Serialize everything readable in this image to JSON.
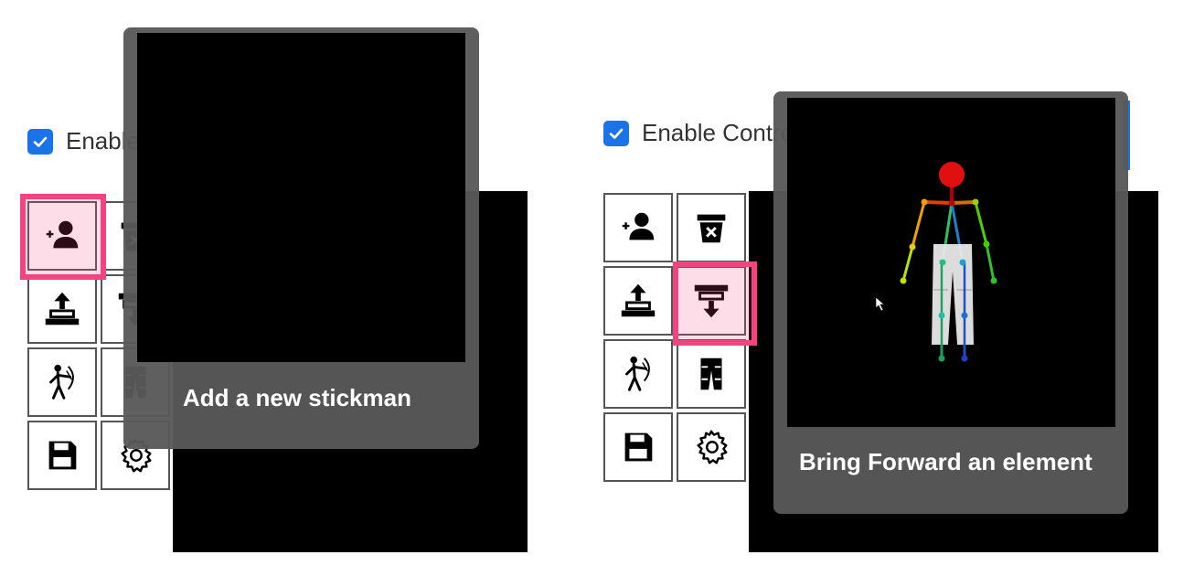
{
  "left_panel": {
    "checkbox_label": "Enable ControlNet",
    "tooltip_text": "Add a new stickman",
    "toolbar": [
      {
        "name": "add-stickman",
        "icon": "person-plus-icon"
      },
      {
        "name": "delete",
        "icon": "trash-x-icon"
      },
      {
        "name": "send-backward",
        "icon": "send-backward-icon"
      },
      {
        "name": "bring-forward",
        "icon": "bring-forward-icon"
      },
      {
        "name": "pose",
        "icon": "archer-icon"
      },
      {
        "name": "pants",
        "icon": "pants-icon"
      },
      {
        "name": "save",
        "icon": "floppy-disk-icon"
      },
      {
        "name": "settings",
        "icon": "gear-icon"
      }
    ],
    "highlighted_button": "add-stickman"
  },
  "right_panel": {
    "checkbox_label": "Enable ControlNet",
    "tooltip_text": "Bring Forward an element",
    "highlighted_button": "bring-forward"
  },
  "colors": {
    "checkbox": "#1a73e8",
    "highlight": "#f2457f",
    "tooltip_bg": "#585858",
    "stickman_head": "#e01010"
  }
}
